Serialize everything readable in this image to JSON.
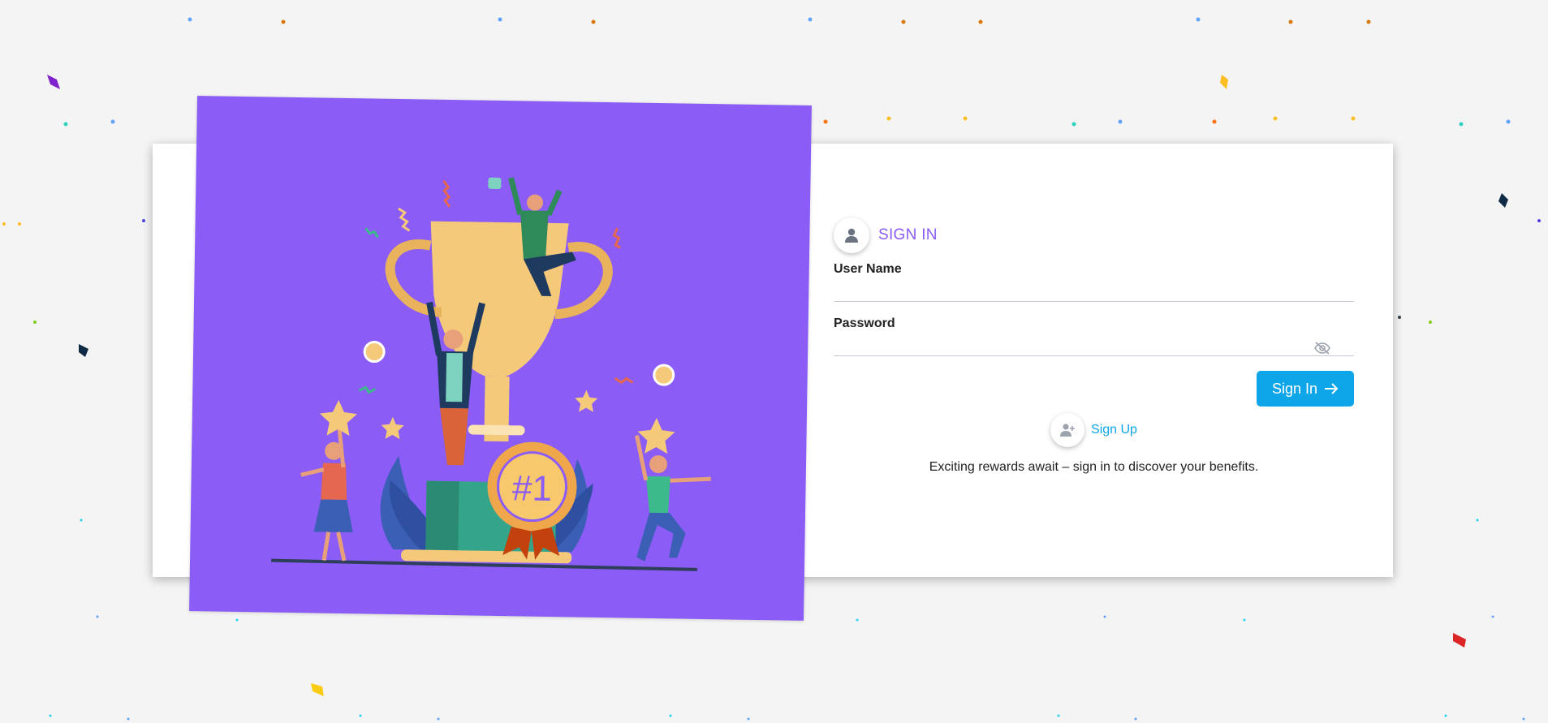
{
  "colors": {
    "accent": "#8b5cf6",
    "primary_button": "#0ea5e9",
    "link": "#0ea5e9",
    "background": "#f4f4f4"
  },
  "signin": {
    "title": "SIGN IN",
    "title_icon": "user-icon",
    "username_label": "User Name",
    "username_value": "",
    "password_label": "Password",
    "password_value": "",
    "password_toggle_icon": "eye-off-icon",
    "submit_label": "Sign In",
    "submit_icon": "arrow-right-icon",
    "signup_icon": "user-plus-icon",
    "signup_label": "Sign Up",
    "tagline": "Exciting rewards await – sign in to discover your benefits."
  },
  "hero": {
    "illustration": "trophy-celebration-illustration",
    "badge_text": "#1"
  }
}
